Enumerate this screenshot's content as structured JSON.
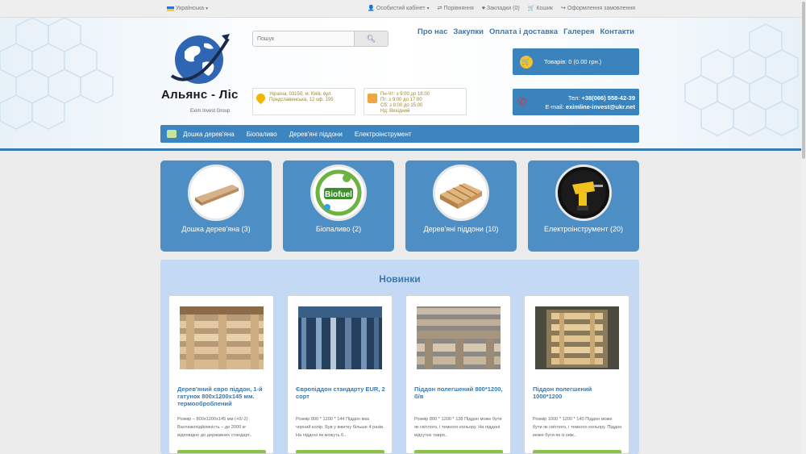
{
  "topbar": {
    "language": "Українська",
    "account": "Особистий кабінет",
    "compare": "Порівняння",
    "bookmarks": "Закладки (0)",
    "cart": "Кошик",
    "checkout": "Оформлення замовлення"
  },
  "brand": {
    "name": "Альянс - Ліс",
    "subtitle": "Exim Invest Group"
  },
  "search": {
    "placeholder": "Пошук"
  },
  "nav_top": [
    "Про нас",
    "Закупки",
    "Оплата і доставка",
    "Галерея",
    "Контакти"
  ],
  "cart_box": {
    "label": "Товарів: 0 (0.00 грн.)"
  },
  "address": {
    "line1": "Україна, 03150, м. Київ, вул.",
    "line2": "Предславинська, 12 оф. 195"
  },
  "hours": {
    "line1": "Пн-Чт: з 9:00 до 18:00",
    "line2": "Пт: з 9:00 до 17:00",
    "line3": "Сб: з 9:00 до 15:00",
    "line4": "Нд: Вихідний"
  },
  "contact": {
    "phone_label": "Тел:",
    "phone": "+38(066) 558-42-39",
    "email_label": "E-mail:",
    "email": "eximline-invest@ukr.net"
  },
  "menu": [
    "Дошка дерев'яна",
    "Біопаливо",
    "Дерев'яні піддони",
    "Електроінструмент"
  ],
  "categories": [
    {
      "title": "Дошка дерев'яна (3)",
      "icon": "wood-plank-icon"
    },
    {
      "title": "Біопаливо (2)",
      "icon": "biofuel-icon"
    },
    {
      "title": "Дерев'яні піддони (10)",
      "icon": "pallet-icon"
    },
    {
      "title": "Електроінструмент (20)",
      "icon": "drill-icon"
    }
  ],
  "novinky": {
    "heading": "Новинки",
    "products": [
      {
        "name": "Дерев'яний євро піддон, 1-й гатунок 800х1200х145 мм. термооброблений",
        "desc": "Розмір – 800х1200х145 мм (+0/-2) Вантажопідйомність – до 2000 кг відповідно до державних стандарт.."
      },
      {
        "name": "Європіддон стандарту EUR, 2 сорт",
        "desc": "Розмір 800 * 1200 * 144 Піддон має чорний колір. Був у вжитку більше 4 разів. На піддоні як можуть б.."
      },
      {
        "name": "Піддон полегшений 800*1200, б/в",
        "desc": "Розмір 800 * 1200 * 138 Піддон може бути як світлого, і темного кольору. На піддоні відсутнє тавро.."
      },
      {
        "name": "Піддон полегшений 1000*1200",
        "desc": "Розмір 1000 * 1200 * 140 Піддон може бути як світлого, і темного кольору. Піддон може бути як із ниж.."
      }
    ]
  },
  "colors": {
    "accent": "#3d85c0",
    "category_bg": "#4d8ec4",
    "link": "#3b78ad",
    "cart_button": "#8bc34a"
  }
}
